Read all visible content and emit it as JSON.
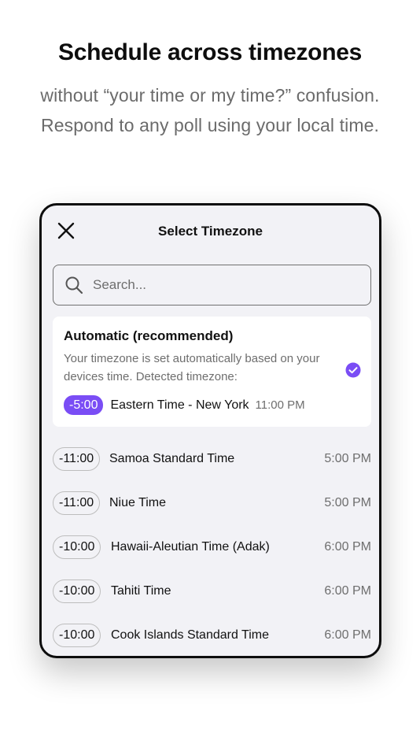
{
  "promo": {
    "headline": "Schedule across timezones",
    "line1": "without “your time or my time?” confusion.",
    "line2": "Respond to any poll using your local time."
  },
  "dialog": {
    "title": "Select Timezone",
    "close_icon": "close-icon",
    "search": {
      "placeholder": "Search...",
      "value": "",
      "icon": "search-icon"
    },
    "automatic": {
      "title": "Automatic (recommended)",
      "description": "Your timezone is set automatically based on your devices time. Detected timezone:",
      "offset": "-5:00",
      "name": "Eastern Time - New York",
      "time": "11:00 PM",
      "selected": true,
      "check_icon": "check-circle-icon"
    },
    "timezones": [
      {
        "offset": "-11:00",
        "name": "Samoa Standard Time",
        "time": "5:00 PM"
      },
      {
        "offset": "-11:00",
        "name": "Niue Time",
        "time": "5:00 PM"
      },
      {
        "offset": "-10:00",
        "name": "Hawaii-Aleutian Time (Adak)",
        "time": "6:00 PM"
      },
      {
        "offset": "-10:00",
        "name": "Tahiti Time",
        "time": "6:00 PM"
      },
      {
        "offset": "-10:00",
        "name": "Cook Islands Standard Time",
        "time": "6:00 PM"
      }
    ]
  },
  "colors": {
    "accent": "#7a4df5",
    "panel_bg": "#f2f2f6",
    "text_dark": "#111111",
    "text_muted": "#6e6e6e"
  }
}
